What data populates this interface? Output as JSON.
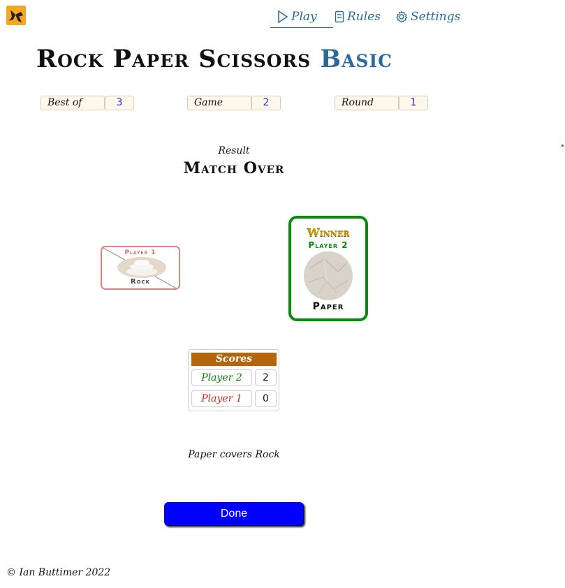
{
  "nav": {
    "play": "Play",
    "rules": "Rules",
    "settings": "Settings"
  },
  "title": {
    "main": "Rock Paper Scissors",
    "accent": "Basic"
  },
  "stats": {
    "best_of_label": "Best of",
    "best_of_value": "3",
    "game_label": "Game",
    "game_value": "2",
    "round_label": "Round",
    "round_value": "1"
  },
  "result": {
    "label": "Result",
    "value": "Match Over"
  },
  "loser_card": {
    "player": "Player 1",
    "choice": "Rock"
  },
  "winner_card": {
    "winner_label": "Winner",
    "player": "Player 2",
    "choice": "Paper"
  },
  "scores": {
    "header": "Scores",
    "rows": [
      {
        "name": "Player 2",
        "score": "2"
      },
      {
        "name": "Player 1",
        "score": "0"
      }
    ]
  },
  "outcome_text": "Paper covers Rock",
  "done_label": "Done",
  "footer": "© Ian Buttimer 2022",
  "colors": {
    "nav": "#2b6a9a",
    "winner_border": "#0a8a0a",
    "loser_border": "#e08080",
    "scores_header": "#b5650b",
    "done_button": "#0000ff"
  },
  "icons": {
    "logo": "hand-logo-icon",
    "play": "play-triangle-icon",
    "rules": "rules-book-icon",
    "settings": "gear-icon"
  }
}
